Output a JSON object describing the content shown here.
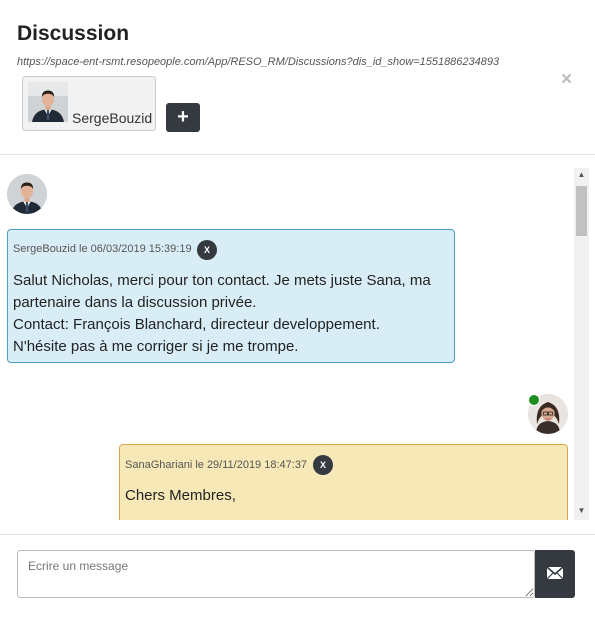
{
  "modal": {
    "title": "Discussion",
    "url": "https://space-ent-rsmt.resopeople.com/App/RESO_RM/Discussions?dis_id_show=1551886234893",
    "close_label": "×"
  },
  "participants": [
    {
      "name": "SergeBouzid"
    }
  ],
  "add_participant_label": "+",
  "messages": [
    {
      "author": "SergeBouzid",
      "meta": "SergeBouzid le 06/03/2019 15:39:19",
      "delete_label": "X",
      "lines": [
        "Salut Nicholas, merci pour ton contact. Je mets juste Sana, ma",
        "partenaire dans la discussion privée.",
        "Contact: François Blanchard, directeur developpement.",
        "N'hésite pas à me corriger si je me trompe."
      ],
      "color": "#d9edf7"
    },
    {
      "author": "SanaGhariani",
      "meta": "SanaGhariani le 29/11/2019 18:47:37",
      "delete_label": "X",
      "lines": [
        "Chers Membres,"
      ],
      "color": "#f7e9b7",
      "online": true
    }
  ],
  "composer": {
    "placeholder": "Ecrire un message",
    "value": ""
  },
  "colors": {
    "dark_button": "#343a40",
    "online": "#1e8e1e"
  }
}
